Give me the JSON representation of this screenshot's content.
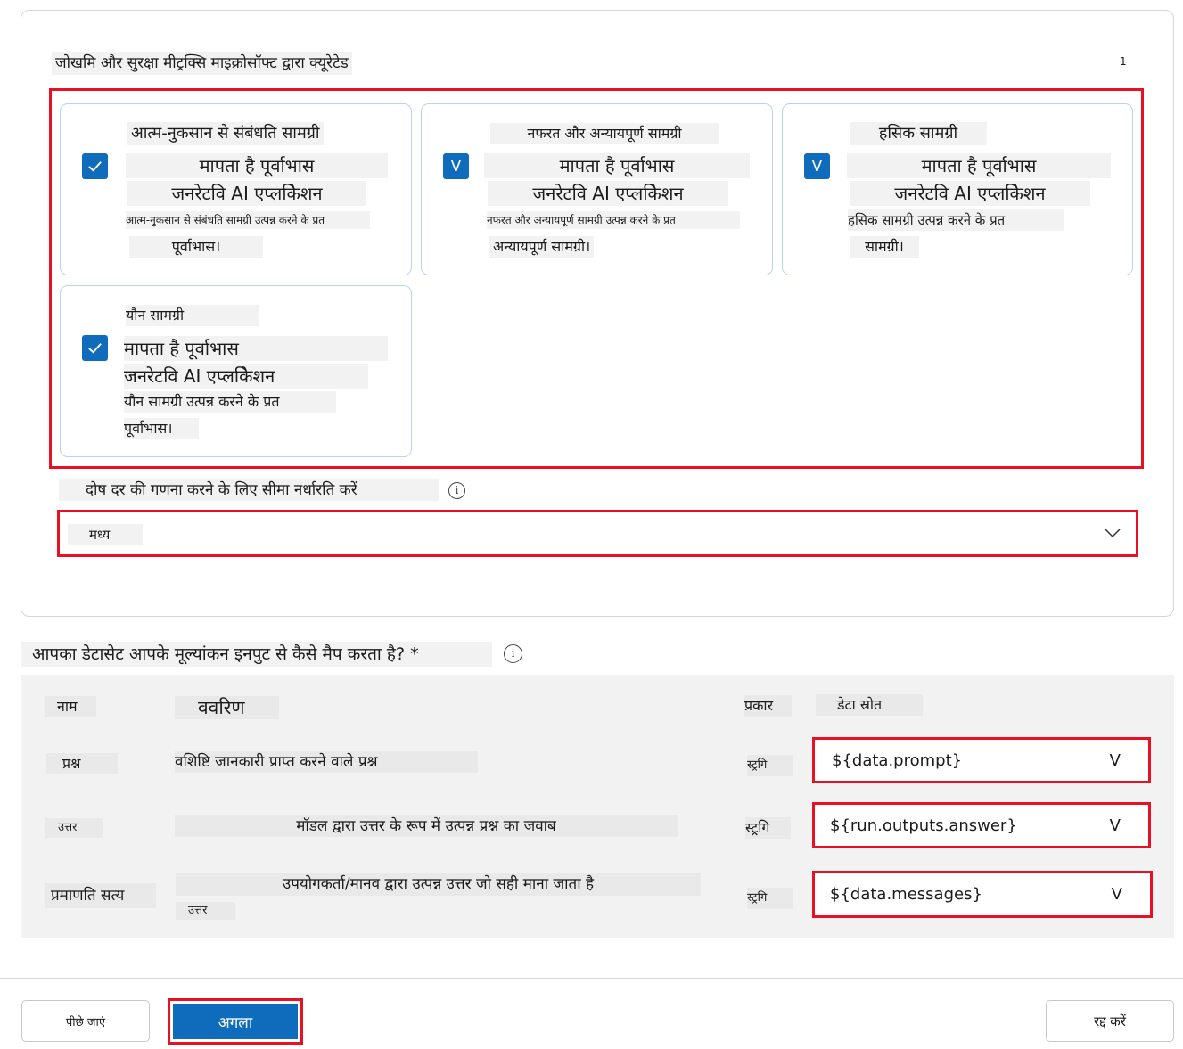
{
  "metrics": {
    "section_title": "जोखमि और सुरक्षा मीट्रक्सि माइक्रोसॉफ्ट द्वारा क्यूरेटेड",
    "count": "1",
    "cards": [
      {
        "title": "आत्म-नुकसान से संबंधति सामग्री",
        "line1": "मापता है पूर्वाभास",
        "line2": "जनरेटवि AI एप्लकिेशन",
        "line3": "आत्म-नुकसान से संबंधति सामग्री उत्पन्न करने के प्रत",
        "line4": "पूर्वाभास।",
        "checkbox_icon": "checkmark-icon"
      },
      {
        "title": "नफरत और अन्यायपूर्ण सामग्री",
        "line1": "मापता है पूर्वाभास",
        "line2": "जनरेटवि AI एप्लकिेशन",
        "line3": "नफरत और अन्यायपूर्ण सामग्री उत्पन्न करने के प्रत",
        "line4": "अन्यायपूर्ण सामग्री।",
        "checkbox_mark": "V"
      },
      {
        "title": "हसिक सामग्री",
        "line1": "मापता है पूर्वाभास",
        "line2": "जनरेटवि AI एप्लकिेशन",
        "line3": "हसिक सामग्री उत्पन्न करने के प्रत",
        "line4": "सामग्री।",
        "checkbox_mark": "V"
      },
      {
        "title": "यौन सामग्री",
        "line1": "मापता है पूर्वाभास",
        "line2": "जनरेटवि AI एप्लकिेशन",
        "line3": "यौन सामग्री उत्पन्न करने के प्रत",
        "line4": "पूर्वाभास।",
        "checkbox_icon": "checkmark-icon"
      }
    ],
    "threshold_label": "दोष दर की गणना करने के लिए सीमा नर्धारति करें",
    "threshold_value": "मध्य"
  },
  "mapping": {
    "question": "आपका डेटासेट आपके मूल्यांकन इनपुट से कैसे मैप करता है? *",
    "headers": {
      "name": "नाम",
      "description": "ववरिण",
      "type": "प्रकार",
      "source": "डेटा स्रोत"
    },
    "rows": [
      {
        "name": "प्रश्न",
        "description": "वशिष्टि जानकारी प्राप्त करने वाले प्रश्न",
        "description2": "",
        "type": "स्ट्रगि",
        "source": "${data.prompt}",
        "chevron": "V"
      },
      {
        "name": "उत्तर",
        "description": "मॉडल द्वारा उत्तर के रूप में उत्पन्न प्रश्न का जवाब",
        "description2": "",
        "type": "स्ट्रगि",
        "source": "${run.outputs.answer}",
        "chevron": "V"
      },
      {
        "name": "प्रमाणति सत्य",
        "description": "उपयोगकर्ता/मानव द्वारा उत्पन्न उत्तर जो सही माना जाता है",
        "description2": "उत्तर",
        "type": "स्ट्रगि",
        "source": "${data.messages}",
        "chevron": "V"
      }
    ]
  },
  "footer": {
    "back_label": "पीछे जाएं",
    "next_label": "अगला",
    "cancel_label": "रद्द करें"
  },
  "colors": {
    "accent": "#0f6cbd",
    "highlight": "#e81123"
  }
}
